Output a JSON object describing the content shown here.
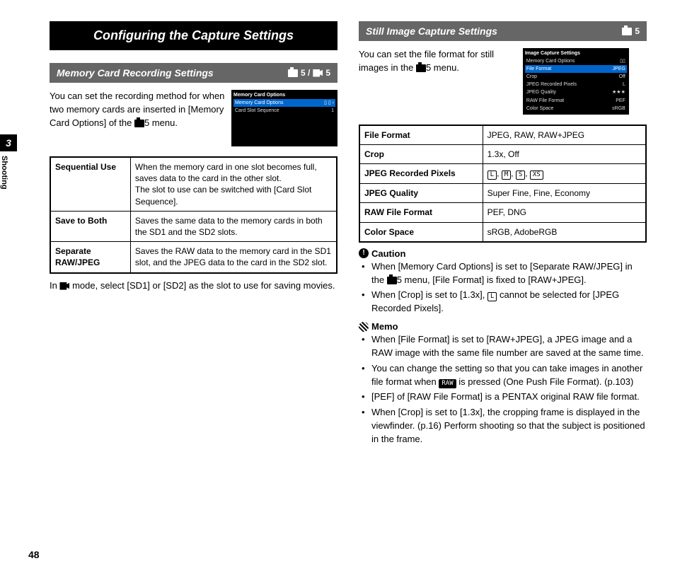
{
  "sidebar": {
    "chapter_num": "3",
    "chapter_label": "Shooting"
  },
  "page_number": "48",
  "chapter_title": "Configuring the Capture Settings",
  "left": {
    "section_title": "Memory Card Recording Settings",
    "section_badge_a": "5 / ",
    "section_badge_b": "5",
    "intro": "You can set the recording method for when two memory cards are inserted in [Memory Card Options] of the ",
    "intro_tail": "5 menu.",
    "thumb": {
      "title": "Memory Card Options",
      "r1k": "Memory Card Options",
      "r1v": "▯ ▯  ›",
      "r2k": "Card Slot Sequence",
      "r2v": "1"
    },
    "table": [
      {
        "k": "Sequential Use",
        "v": "When the memory card in one slot becomes full, saves data to the card in the other slot.\nThe slot to use can be switched with [Card Slot Sequence]."
      },
      {
        "k": "Save to Both",
        "v": "Saves the same data to the memory cards in both the SD1 and the SD2 slots."
      },
      {
        "k": "Separate RAW/JPEG",
        "v": "Saves the RAW data to the memory card in the SD1 slot, and the JPEG data to the card in the SD2 slot."
      }
    ],
    "footnote_a": "In ",
    "footnote_b": " mode, select [SD1] or [SD2] as the slot to use for saving movies."
  },
  "right": {
    "section_title": "Still Image Capture Settings",
    "section_badge": "5",
    "intro_a": "You can set the file format for still images in the ",
    "intro_b": "5 menu.",
    "thumb": {
      "title": "Image Capture Settings",
      "rows": [
        [
          "Memory Card Options",
          "▯▯"
        ],
        [
          "File Format",
          "JPEG"
        ],
        [
          "Crop",
          "Off"
        ],
        [
          "JPEG Recorded Pixels",
          "L"
        ],
        [
          "JPEG Quality",
          "★★★"
        ],
        [
          "RAW File Format",
          "PEF"
        ],
        [
          "Color Space",
          "sRGB"
        ]
      ]
    },
    "table": [
      {
        "k": "File Format",
        "v": "JPEG, RAW, RAW+JPEG"
      },
      {
        "k": "Crop",
        "v": "1.3x, Off"
      },
      {
        "k": "JPEG Recorded Pixels",
        "v_sizes": [
          "L",
          "M",
          "S",
          "XS"
        ]
      },
      {
        "k": "JPEG Quality",
        "v": "Super Fine, Fine, Economy"
      },
      {
        "k": "RAW File Format",
        "v": "PEF, DNG"
      },
      {
        "k": "Color Space",
        "v": "sRGB, AdobeRGB"
      }
    ],
    "caution_h": "Caution",
    "caution": [
      {
        "pre": "When [Memory Card Options] is set to [Separate RAW/JPEG] in the ",
        "mid": "5 menu, [File Format] is fixed to [RAW+JPEG]."
      },
      {
        "pre": "When [Crop] is set to [1.3x], ",
        "sz": "L",
        "post": " cannot be selected for [JPEG Recorded Pixels]."
      }
    ],
    "memo_h": "Memo",
    "memo": [
      "When [File Format] is set to [RAW+JPEG], a JPEG image and a RAW image with the same file number are saved at the same time.",
      {
        "pre": "You can change the setting so that you can take images in another file format when ",
        "raw": "RAW",
        "post": " is pressed (One Push File Format). (p.103)"
      },
      "[PEF] of [RAW File Format] is a PENTAX original RAW file format.",
      "When [Crop] is set to [1.3x], the cropping frame is displayed in the viewfinder. (p.16) Perform shooting so that the subject is positioned in the frame."
    ]
  }
}
